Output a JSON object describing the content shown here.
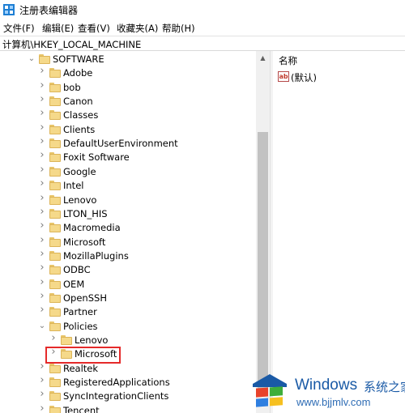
{
  "window": {
    "title": "注册表编辑器",
    "icon": "regedit-icon"
  },
  "menu": [
    "文件(F)",
    "编辑(E)",
    "查看(V)",
    "收藏夹(A)",
    "帮助(H)"
  ],
  "address": {
    "path": "计算机\\HKEY_LOCAL_MACHINE"
  },
  "tree": {
    "items": [
      {
        "label": "SOFTWARE",
        "expanded": true
      },
      {
        "label": "Adobe"
      },
      {
        "label": "bob"
      },
      {
        "label": "Canon"
      },
      {
        "label": "Classes"
      },
      {
        "label": "Clients"
      },
      {
        "label": "DefaultUserEnvironment"
      },
      {
        "label": "Foxit Software"
      },
      {
        "label": "Google"
      },
      {
        "label": "Intel"
      },
      {
        "label": "Lenovo"
      },
      {
        "label": "LTON_HIS"
      },
      {
        "label": "Macromedia"
      },
      {
        "label": "Microsoft"
      },
      {
        "label": "MozillaPlugins"
      },
      {
        "label": "ODBC"
      },
      {
        "label": "OEM"
      },
      {
        "label": "OpenSSH"
      },
      {
        "label": "Partner"
      },
      {
        "label": "Policies",
        "expanded": true
      },
      {
        "label": "Lenovo"
      },
      {
        "label": "Microsoft",
        "highlighted": true
      },
      {
        "label": "Realtek"
      },
      {
        "label": "RegisteredApplications"
      },
      {
        "label": "SyncIntegrationClients"
      },
      {
        "label": "Tencent"
      }
    ]
  },
  "values_pane": {
    "column_name": "名称",
    "rows": [
      {
        "icon": "string-value-icon",
        "icon_text": "ab",
        "name": "(默认)"
      }
    ]
  },
  "watermark": {
    "brand": "Windows",
    "cn": "系统之家",
    "url": "www.bjjmlv.com"
  },
  "colors": {
    "highlight_box": "#e52a2a",
    "folder": "#f5d98a",
    "watermark_blue": "#1a5aa6"
  }
}
